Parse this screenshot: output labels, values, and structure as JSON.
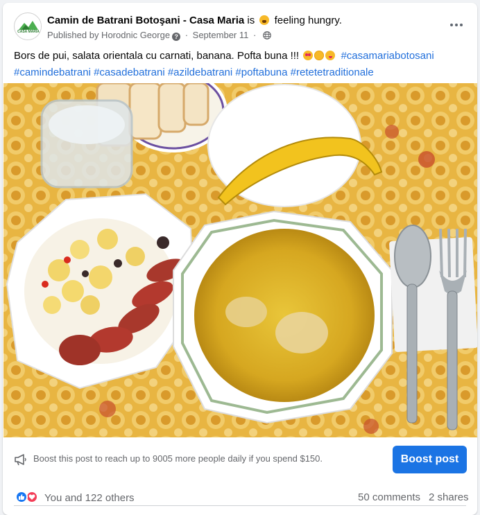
{
  "colors": {
    "link": "#216fdb",
    "boost_button": "#1b74e4",
    "like_reaction": "#1877f2",
    "love_reaction": "#f33e58",
    "secondary_text": "#65676b"
  },
  "post": {
    "page_name": "Camin de Batrani Botoşani - Casa Maria",
    "feeling_prefix": "is",
    "feeling_emoji": "hungry-face-emoji",
    "feeling_text": "feeling hungry.",
    "published_by": "Published by Horodnic George",
    "date": "September 11",
    "privacy_icon": "globe-icon",
    "more_icon": "more-options-icon",
    "avatar_text": "CASA MARIA",
    "text": "Bors de pui, salata orientala cu carnati, banana. Pofta buna !!!",
    "emojis": [
      "heart-eyes-emoji",
      "smiling-face-with-hearts-emoji",
      "face-savoring-food-emoji"
    ],
    "hashtags": [
      "#casamariabotosani",
      "#camindebatrani",
      "#casadebatrani",
      "#azildebatrani",
      "#poftabuna",
      "#retetetraditionale"
    ],
    "photo_description_icon": "photo"
  },
  "boost": {
    "text": "Boost this post to reach up to 9005 more people daily if you spend $150.",
    "button_label": "Boost post",
    "icon": "megaphone-icon"
  },
  "stats": {
    "reaction_icons": [
      "like-icon",
      "love-icon"
    ],
    "reactions_text": "You and 122 others",
    "comments_text": "50 comments",
    "shares_text": "2 shares"
  }
}
